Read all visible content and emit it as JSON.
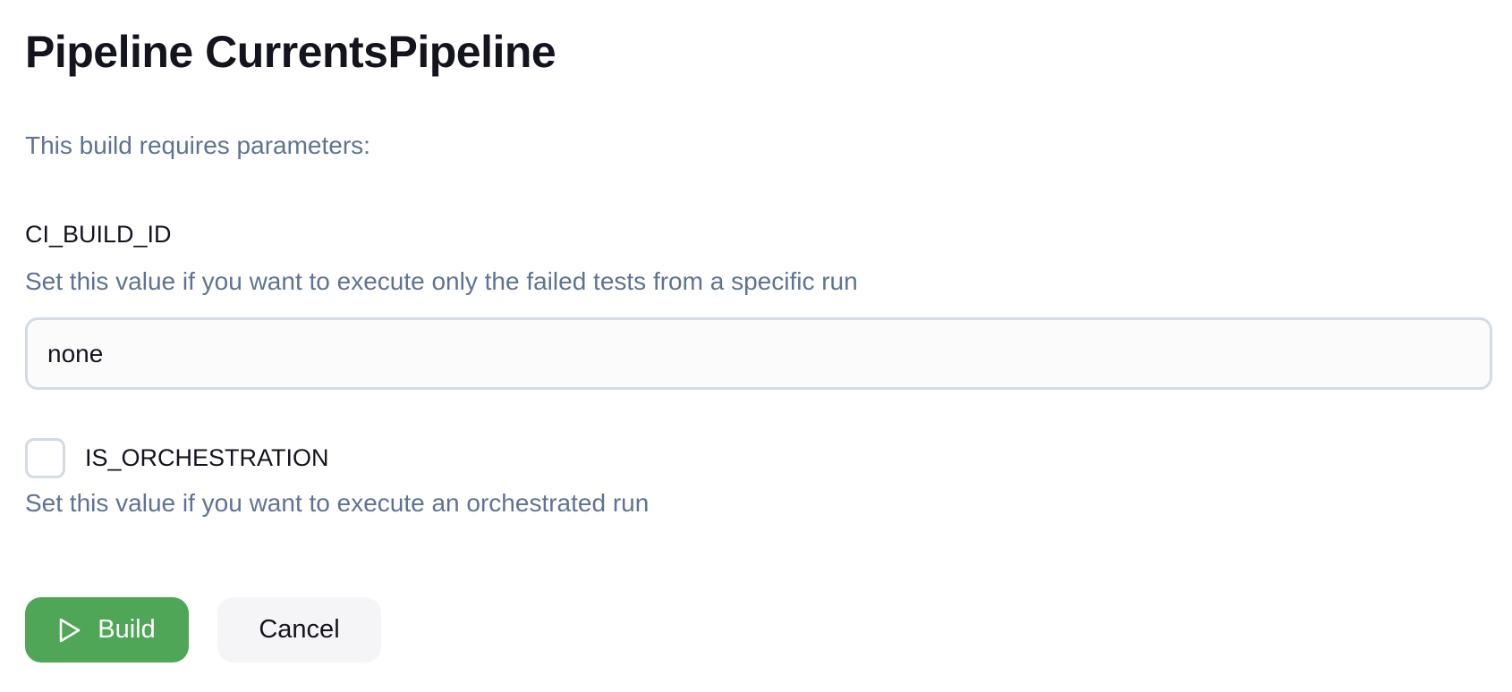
{
  "page": {
    "title": "Pipeline CurrentsPipeline",
    "intro": "This build requires parameters:"
  },
  "params": {
    "ci_build_id": {
      "name": "CI_BUILD_ID",
      "description": "Set this value if you want to execute only the failed tests from a specific run",
      "value": "none"
    },
    "is_orchestration": {
      "name": "IS_ORCHESTRATION",
      "description": "Set this value if you want to execute an orchestrated run",
      "checked": false
    }
  },
  "actions": {
    "build_label": "Build",
    "build_icon": "play-icon",
    "cancel_label": "Cancel"
  },
  "colors": {
    "primary": "#4ea656",
    "muted_text": "#5e7394",
    "border": "#d4dbe4"
  }
}
